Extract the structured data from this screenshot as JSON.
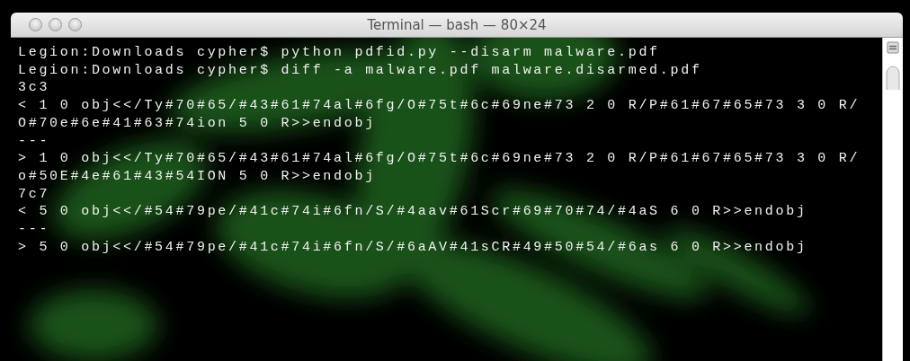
{
  "window": {
    "title": "Terminal — bash — 80×24"
  },
  "terminal": {
    "lines": [
      "Legion:Downloads cypher$ python pdfid.py --disarm malware.pdf",
      "Legion:Downloads cypher$ diff -a malware.pdf malware.disarmed.pdf",
      "3c3",
      "< 1 0 obj<</Ty#70#65/#43#61#74al#6fg/O#75t#6c#69ne#73 2 0 R/P#61#67#65#73 3 0 R/",
      "O#70e#6e#41#63#74ion 5 0 R>>endobj",
      "---",
      "> 1 0 obj<</Ty#70#65/#43#61#74al#6fg/O#75t#6c#69ne#73 2 0 R/P#61#67#65#73 3 0 R/",
      "o#50E#4e#61#43#54ION 5 0 R>>endobj",
      "7c7",
      "< 5 0 obj<</#54#79pe/#41c#74i#6fn/S/#4aav#61Scr#69#70#74/#4aS 6 0 R>>endobj",
      "---",
      "> 5 0 obj<</#54#79pe/#41c#74i#6fn/S/#6aAV#41sCR#49#50#54/#6as 6 0 R>>endobj"
    ]
  }
}
